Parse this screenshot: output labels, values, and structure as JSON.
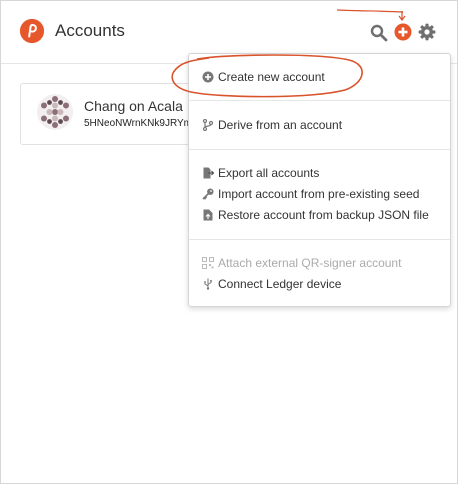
{
  "header": {
    "title": "Accounts",
    "logo_icon": "polkadot-logo-icon",
    "brand_color": "#e6582b",
    "icons": {
      "search": "search-icon",
      "add": "plus-circle-icon",
      "settings": "gear-icon"
    }
  },
  "account": {
    "name": "Chang on Acala",
    "address": "5HNeoNWrnKNk9JRYm"
  },
  "menu": {
    "sections": [
      {
        "items": [
          {
            "label": "Create new account",
            "icon": "plus-circle-icon",
            "disabled": false
          }
        ]
      },
      {
        "items": [
          {
            "label": "Derive from an account",
            "icon": "branch-icon",
            "disabled": false
          }
        ]
      },
      {
        "items": [
          {
            "label": "Export all accounts",
            "icon": "file-export-icon",
            "disabled": false
          },
          {
            "label": "Import account from pre-existing seed",
            "icon": "key-icon",
            "disabled": false
          },
          {
            "label": "Restore account from backup JSON file",
            "icon": "file-upload-icon",
            "disabled": false
          }
        ]
      },
      {
        "items": [
          {
            "label": "Attach external QR-signer account",
            "icon": "qrcode-icon",
            "disabled": true
          },
          {
            "label": "Connect Ledger device",
            "icon": "usb-icon",
            "disabled": false
          }
        ]
      }
    ]
  },
  "annotation_color": "#d9532b"
}
